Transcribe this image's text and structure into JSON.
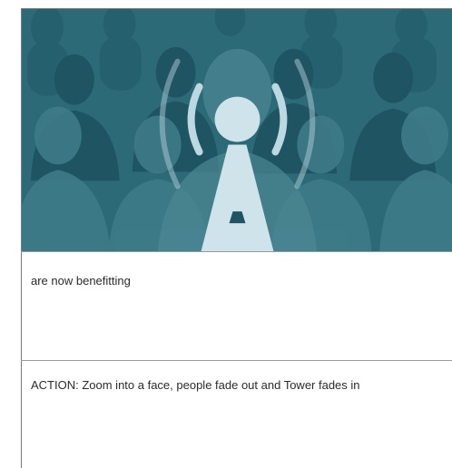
{
  "panel": {
    "caption": "are now benefitting",
    "action_note": "ACTION: Zoom into a face, people fade out and Tower fades in"
  },
  "illustration": {
    "subject": "crowd of people with broadcast tower",
    "colors": {
      "background": "#2d6a78",
      "crowd": "#1f5563",
      "crowd_light": "#3f7c89",
      "tower": "#cfe3ea",
      "waves": "#bcd8e1"
    }
  }
}
